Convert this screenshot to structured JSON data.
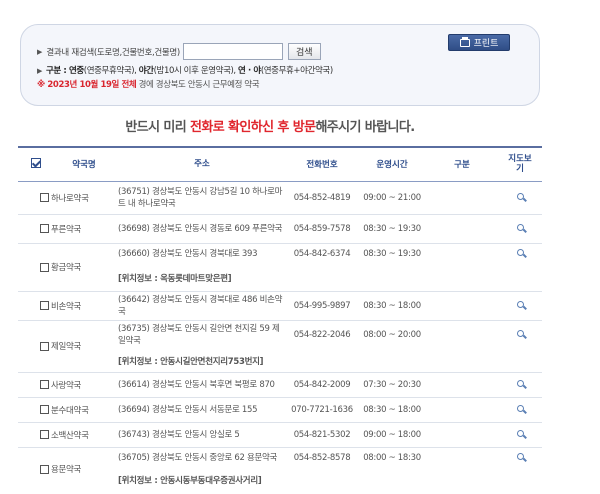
{
  "search": {
    "label": "결과내 재검색(도로명,건물번호,건물명)",
    "input_value": "",
    "button": "검색",
    "legend_prefix": "구분 : ",
    "legend_b1": "연중",
    "legend_t1": "(연중무휴약국), ",
    "legend_b2": "야간",
    "legend_t2": "(밤10시 이후 운영약국), ",
    "legend_b3": "연 · 야",
    "legend_t3": "(연중무휴+야간약국)",
    "notice_date": "※ 2023년 10월 19일 전체",
    "notice_rest": " 경에  경상북도  안동시   근무예정 약국"
  },
  "print_button": "프린트",
  "banner": {
    "pre": "반드시 미리 ",
    "red1": "전화로 확인하신 후 방문",
    "post": "해주시기 바랍니다."
  },
  "table": {
    "headers": {
      "name": "약국명",
      "address": "주소",
      "tel": "전화번호",
      "hours": "운영시간",
      "kind": "구분",
      "map": "지도보기"
    },
    "rows": [
      {
        "name": "하나로약국",
        "address": "(36751) 경상북도 안동시 강남5길 10 하나로마트 내 하나로약국",
        "tel": "054-852-4819",
        "hours": "09:00 ~ 21:00"
      },
      {
        "name": "푸른약국",
        "address": "(36698) 경상북도 안동시 경동로 609 푸른약국",
        "tel": "054-859-7578",
        "hours": "08:30 ~ 19:30"
      },
      {
        "name": "황금약국",
        "address": "(36660) 경상북도 안동시 경북대로 393",
        "tel": "054-842-6374",
        "hours": "08:30 ~ 19:30",
        "location": "[위치정보 : 옥동롯데마트맞은편]"
      },
      {
        "name": "비손약국",
        "address": "(36642) 경상북도 안동시 경북대로 486 비손약국",
        "tel": "054-995-9897",
        "hours": "08:30 ~ 18:00"
      },
      {
        "name": "제일약국",
        "address": "(36735) 경상북도 안동시 길안면 천지길 59 제일약국",
        "tel": "054-822-2046",
        "hours": "08:00 ~ 20:00",
        "location": "[위치정보 : 안동시길안면천지리753번지]"
      },
      {
        "name": "사랑약국",
        "address": "(36614) 경상북도 안동시 북후면 북평로 870",
        "tel": "054-842-2009",
        "hours": "07:30 ~ 20:30"
      },
      {
        "name": "분수대약국",
        "address": "(36694) 경상북도 안동시 서동문로 155",
        "tel": "070-7721-1636",
        "hours": "08:30 ~ 18:00"
      },
      {
        "name": "소백산약국",
        "address": "(36743) 경상북도 안동시 앙실로 5",
        "tel": "054-821-5302",
        "hours": "09:00 ~ 18:00"
      },
      {
        "name": "용문약국",
        "address": "(36705) 경상북도 안동시 중앙로 62 용문약국",
        "tel": "054-852-8578",
        "hours": "08:00 ~ 18:30",
        "location": "[위치정보 : 안동시동부동대우증권사거리]"
      }
    ]
  },
  "colors": {
    "accent": "#2f4e8c",
    "notice_red": "#d9262f"
  },
  "icons": {
    "map": "magnifier-icon",
    "print": "printer-icon"
  }
}
